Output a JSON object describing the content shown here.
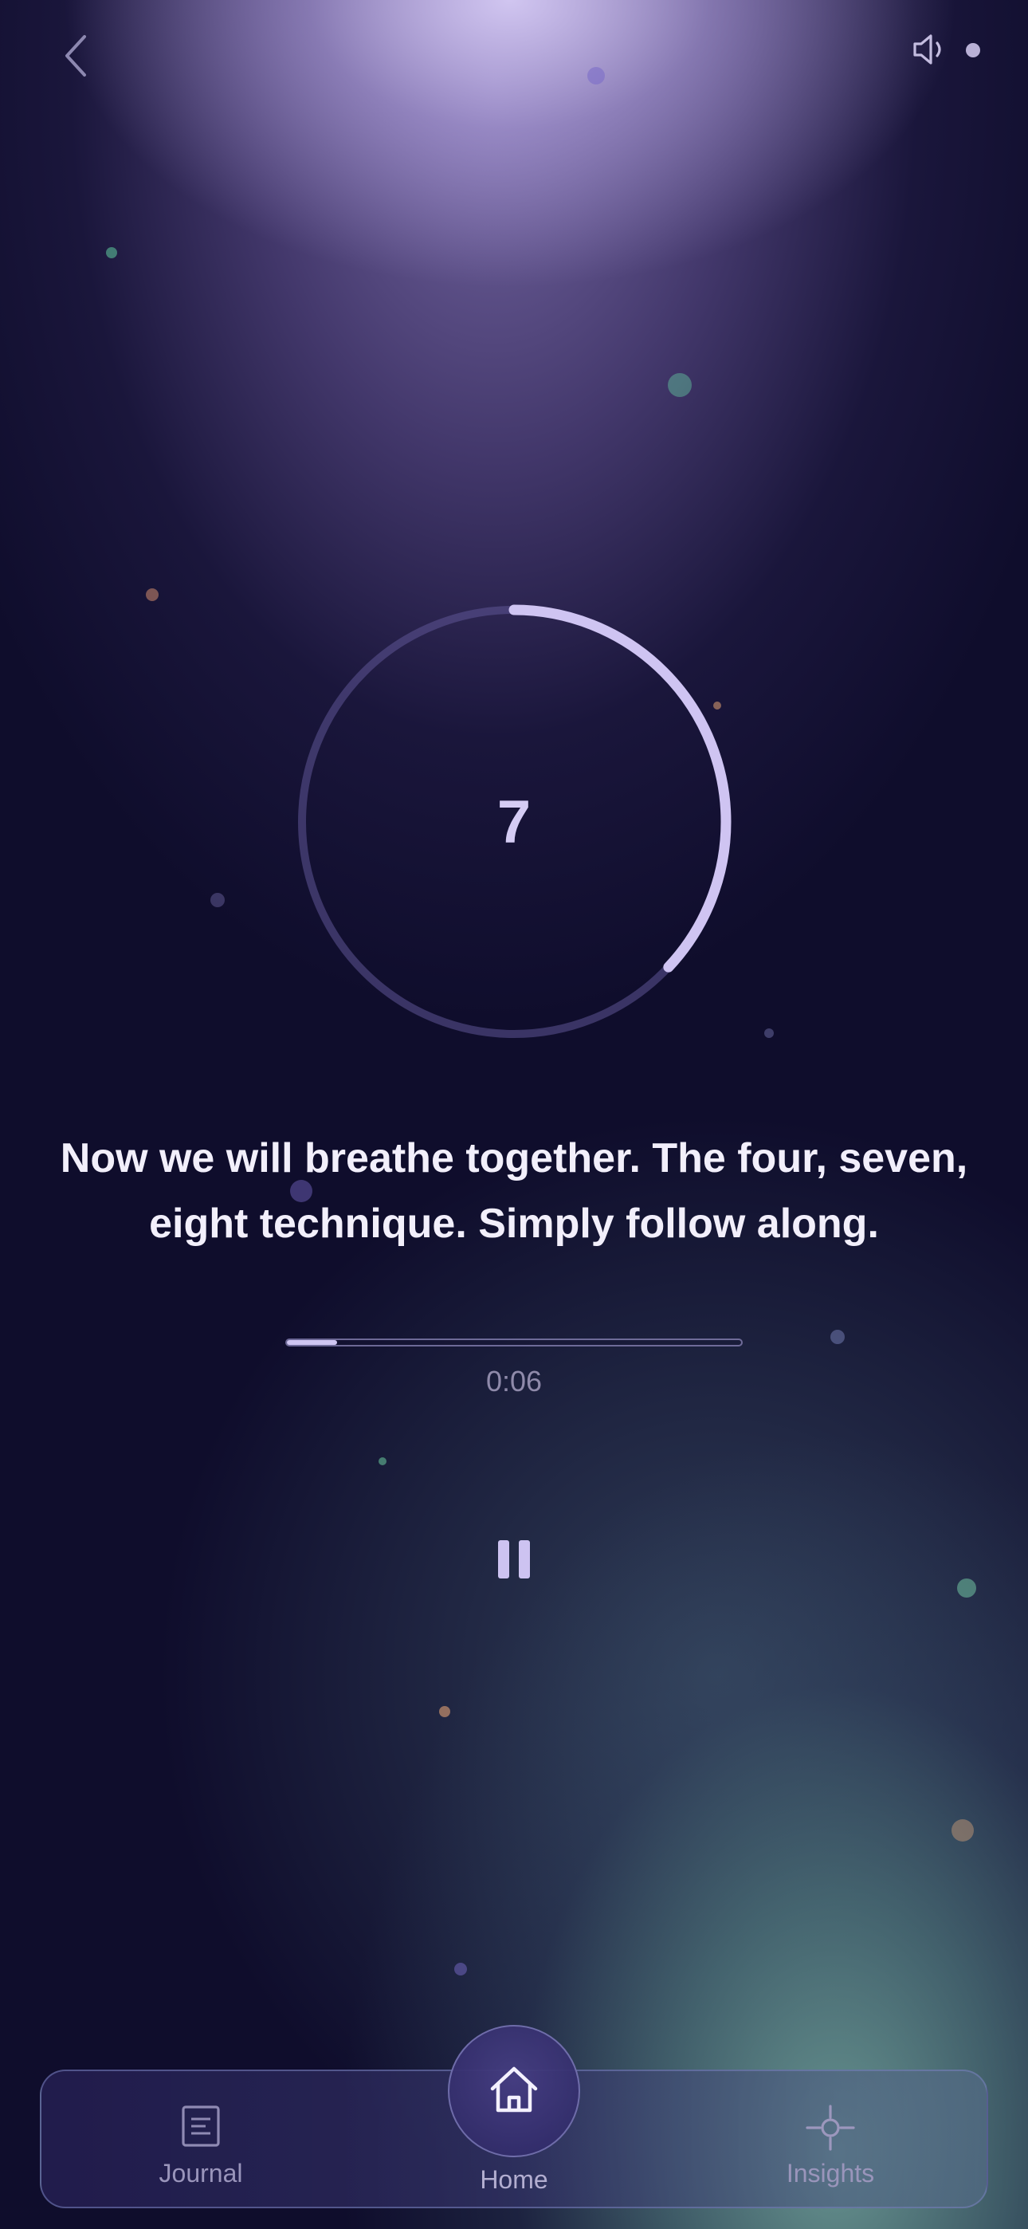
{
  "top_bar": {
    "back_icon": "chevron-left-icon",
    "sound_icon": "speaker-icon",
    "status_dot_color": "#b9b1d6"
  },
  "breathing_timer": {
    "count": "7",
    "progress_fraction": 0.37,
    "arc_color": "#cfc4f2",
    "track_color": "rgba(95,85,150,0.55)"
  },
  "caption": {
    "line1": "Now we will breathe together. The four, seven,",
    "line2": "eight technique. Simply follow along."
  },
  "playback": {
    "elapsed": "0:06",
    "progress_percent": 11,
    "pause_icon": "pause-icon"
  },
  "nav": {
    "journal": {
      "label": "Journal",
      "icon": "journal-icon"
    },
    "home": {
      "label": "Home",
      "icon": "home-icon"
    },
    "insights": {
      "label": "Insights",
      "icon": "insights-icon"
    }
  },
  "colors": {
    "background": "#0f0d2c",
    "accent": "#cfc6f2",
    "caption_text": "#f2effb"
  }
}
